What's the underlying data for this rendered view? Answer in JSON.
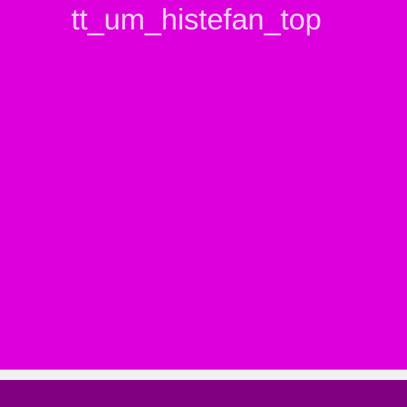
{
  "screen": {
    "title": "tt_um_histefan_top"
  },
  "colors": {
    "background": "#dc00dc",
    "title_text": "#f6d6f6",
    "divider": "#f1f1f1",
    "bottom_bar": "#800080"
  }
}
